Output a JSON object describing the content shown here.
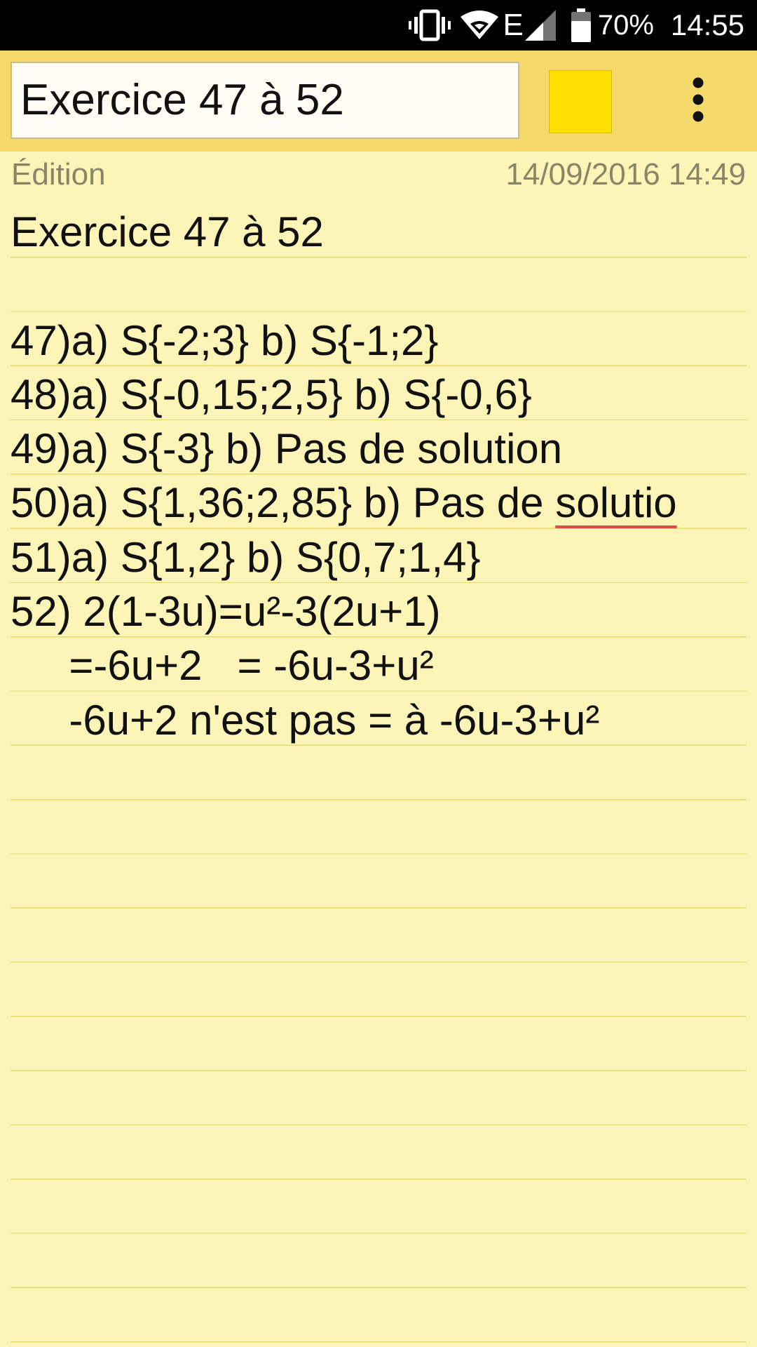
{
  "status_bar": {
    "network_label": "E",
    "battery_percent": "70%",
    "time": "14:55",
    "icons": [
      "vibrate-icon",
      "wifi-icon",
      "signal-icon",
      "battery-icon"
    ]
  },
  "toolbar": {
    "title_value": "Exercice 47 à 52",
    "color_swatch": "#ffe000",
    "menu_icon": "more-vert-icon"
  },
  "meta": {
    "mode": "Édition",
    "timestamp": "14/09/2016 14:49"
  },
  "note": {
    "lines": [
      "Exercice 47 à 52",
      "",
      "47)a) S{-2;3} b) S{-1;2}",
      "48)a) S{-0,15;2,5} b) S{-0,6}",
      "49)a) S{-3} b) Pas de solution",
      "50)a) S{1,36;2,85} b) Pas de solutio",
      "51)a) S{1,2} b) S{0,7;1,4}",
      "52) 2(1-3u)=u²-3(2u+1)",
      "     =-6u+2   = -6u-3+u²",
      "     -6u+2 n'est pas = à -6u-3+u²"
    ],
    "line5_prefix": "50)a) S{1,36;2,85} b) Pas de ",
    "line5_misspelled": "solutio"
  },
  "colors": {
    "paper": "#fdf5b8",
    "toolbar": "#f5d96b",
    "rule_line": "#e3da6b",
    "spell_underline": "#e8474a"
  }
}
